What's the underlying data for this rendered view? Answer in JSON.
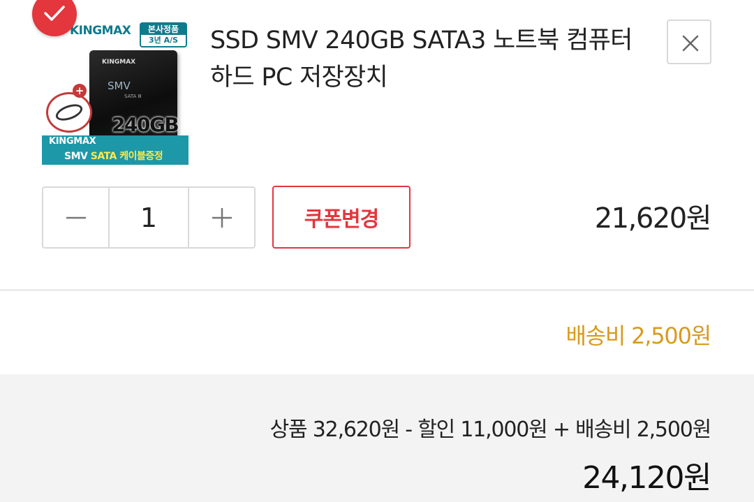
{
  "product": {
    "title": "SSD SMV 240GB SATA3 노트북 컴퓨터 하드 PC 저장장치",
    "image": {
      "brand": "KINGMAX",
      "badge_line1": "본사정품",
      "badge_line2": "3년 A/S",
      "ssd_brand": "KINGMAX",
      "ssd_model": "SMV",
      "ssd_sub": "SATA Ⅲ",
      "capacity": "240GB",
      "band_line1": "KINGMAX",
      "band_model": "SMV",
      "band_highlight": "SATA 케이블증정"
    },
    "selected": true,
    "icons": {
      "check": "check-icon",
      "remove": "close-icon",
      "decrement": "minus-icon",
      "increment": "plus-icon"
    }
  },
  "quantity": {
    "value": "1"
  },
  "coupon": {
    "label": "쿠폰변경"
  },
  "price": {
    "item_price": "21,620원"
  },
  "shipping": {
    "label": "배송비 2,500원"
  },
  "summary": {
    "breakdown": "상품 32,620원 - 할인 11,000원 + 배송비 2,500원",
    "total": "24,120원"
  },
  "colors": {
    "accent_red": "#e3363d",
    "shipping_orange": "#d99a1e",
    "summary_bg": "#f3f3f3",
    "border_gray": "#d9d9d9"
  }
}
